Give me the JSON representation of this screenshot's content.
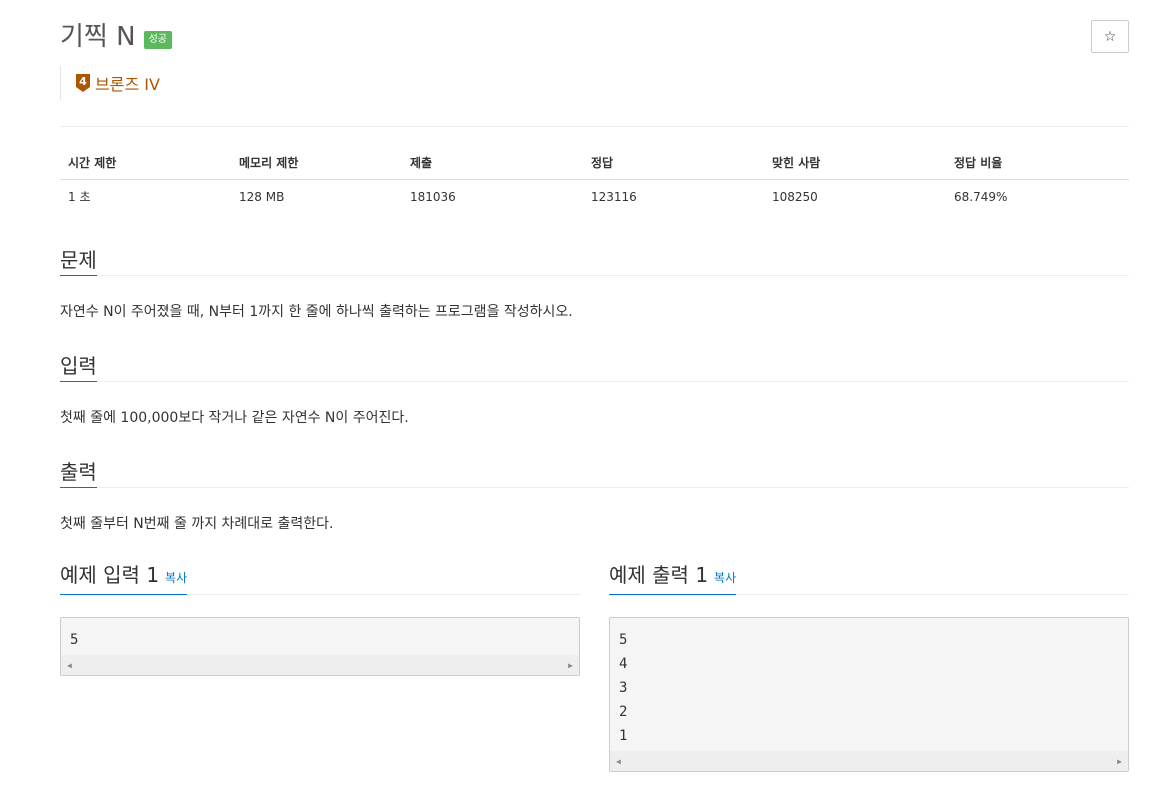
{
  "problem": {
    "title": "기찍 N",
    "status_badge": "성공",
    "tier_label": "브론즈 IV",
    "tier_number": "4"
  },
  "colors": {
    "badge": "#5cb85c",
    "tier": "#ad5600",
    "accent": "#0076c0"
  },
  "icons": {
    "star": "star-icon",
    "tier": "bronze-tier-icon"
  },
  "info_table": {
    "headers": [
      "시간 제한",
      "메모리 제한",
      "제출",
      "정답",
      "맞힌 사람",
      "정답 비율"
    ],
    "values": [
      "1 초",
      "128 MB",
      "181036",
      "123116",
      "108250",
      "68.749%"
    ]
  },
  "sections": {
    "description": {
      "heading": "문제",
      "text": "자연수 N이 주어졌을 때, N부터 1까지 한 줄에 하나씩 출력하는 프로그램을 작성하시오."
    },
    "input": {
      "heading": "입력",
      "text": "첫째 줄에 100,000보다 작거나 같은 자연수 N이 주어진다."
    },
    "output": {
      "heading": "출력",
      "text": "첫째 줄부터 N번째 줄 까지 차례대로 출력한다."
    }
  },
  "samples": {
    "input": {
      "heading": "예제 입력 1",
      "copy_label": "복사",
      "lines": [
        "5"
      ]
    },
    "output": {
      "heading": "예제 출력 1",
      "copy_label": "복사",
      "lines": [
        "5",
        "4",
        "3",
        "2",
        "1"
      ]
    }
  }
}
